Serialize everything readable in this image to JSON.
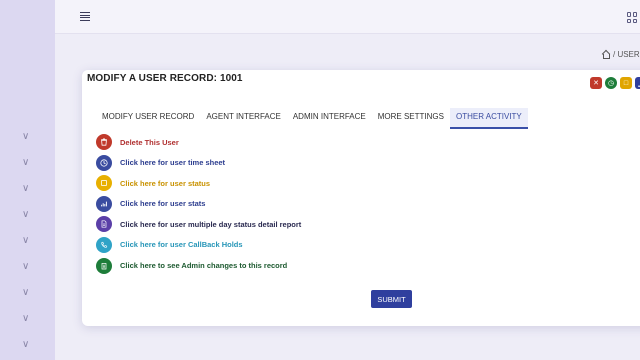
{
  "colors": {
    "sidebar_bg": "#dcd8f1",
    "page_bg": "#eeedf7",
    "primary": "#2f3f9e",
    "danger": "#c0392b",
    "success": "#1e7d3a",
    "warning": "#e0a500",
    "info": "#2fa3c7"
  },
  "header": {
    "menu_icon": "hamburger-icon",
    "apps_icon": "grid-icon"
  },
  "breadcrumb": {
    "home_icon": "home-icon",
    "text": "/ USER"
  },
  "card": {
    "title": "MODIFY A USER RECORD: 1001",
    "top_icons": [
      {
        "icon": "trash-icon",
        "color": "#c0392b"
      },
      {
        "icon": "clock-icon",
        "color": "#1e7d3a"
      },
      {
        "icon": "square-icon",
        "color": "#e0a500"
      },
      {
        "icon": "chart-icon",
        "color": "#2f3f9e"
      }
    ]
  },
  "tabs": [
    {
      "label": "MODIFY USER RECORD",
      "active": false
    },
    {
      "label": "AGENT INTERFACE",
      "active": false
    },
    {
      "label": "ADMIN INTERFACE",
      "active": false
    },
    {
      "label": "MORE SETTINGS",
      "active": false
    },
    {
      "label": "OTHER ACTIVITY",
      "active": true
    }
  ],
  "actions": [
    {
      "label": "Delete This User",
      "icon": "trash-icon",
      "color": "#c0392b",
      "text_color": "#b03030"
    },
    {
      "label": "Click here for user time sheet",
      "icon": "clock-icon",
      "color": "#3a4ca0",
      "text_color": "#2c3d8f"
    },
    {
      "label": "Click here for user status",
      "icon": "square-icon",
      "color": "#e8b000",
      "text_color": "#c99200"
    },
    {
      "label": "Click here for user stats",
      "icon": "bar-chart-icon",
      "color": "#3a4ca0",
      "text_color": "#2c3d8f"
    },
    {
      "label": "Click here for user multiple day status detail report",
      "icon": "document-icon",
      "color": "#5b3fa8",
      "text_color": "#2a2a50"
    },
    {
      "label": "Click here for user CallBack Holds",
      "icon": "phone-icon",
      "color": "#2fa3c7",
      "text_color": "#2796b8"
    },
    {
      "label": "Click here to see Admin changes to this record",
      "icon": "clipboard-icon",
      "color": "#1e7d3a",
      "text_color": "#1d5a30"
    }
  ],
  "submit_label": "SUBMIT"
}
